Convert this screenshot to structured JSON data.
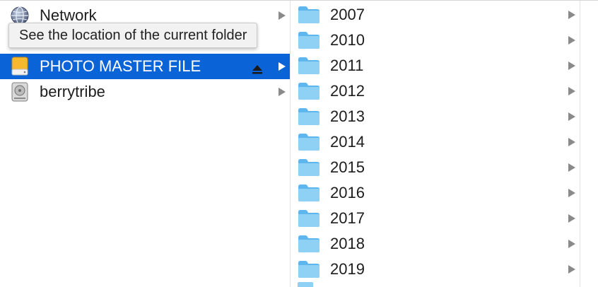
{
  "sidebar": {
    "items": [
      {
        "label": "Network",
        "icon": "globe-icon",
        "selected": false,
        "has_chevron": true
      },
      {
        "label": "",
        "icon": "disk-icon",
        "selected": false,
        "has_chevron": false
      },
      {
        "label": "PHOTO MASTER FILE",
        "icon": "external-drive-icon",
        "selected": true,
        "has_chevron": true,
        "ejectable": true
      },
      {
        "label": "berrytribe",
        "icon": "internal-drive-icon",
        "selected": false,
        "has_chevron": true
      }
    ]
  },
  "tooltip": {
    "text": "See the location of the current folder"
  },
  "folders": {
    "items": [
      {
        "label": "2007",
        "icon": "folder-icon"
      },
      {
        "label": "2010",
        "icon": "folder-icon"
      },
      {
        "label": "2011",
        "icon": "folder-icon"
      },
      {
        "label": "2012",
        "icon": "folder-icon"
      },
      {
        "label": "2013",
        "icon": "folder-icon"
      },
      {
        "label": "2014",
        "icon": "folder-icon"
      },
      {
        "label": "2015",
        "icon": "folder-icon"
      },
      {
        "label": "2016",
        "icon": "folder-icon"
      },
      {
        "label": "2017",
        "icon": "folder-icon"
      },
      {
        "label": "2018",
        "icon": "folder-icon"
      },
      {
        "label": "2019",
        "icon": "folder-icon"
      }
    ]
  },
  "colors": {
    "selection": "#0a64d8",
    "folder": "#6ec1f3",
    "drive": "#f5b82e"
  }
}
